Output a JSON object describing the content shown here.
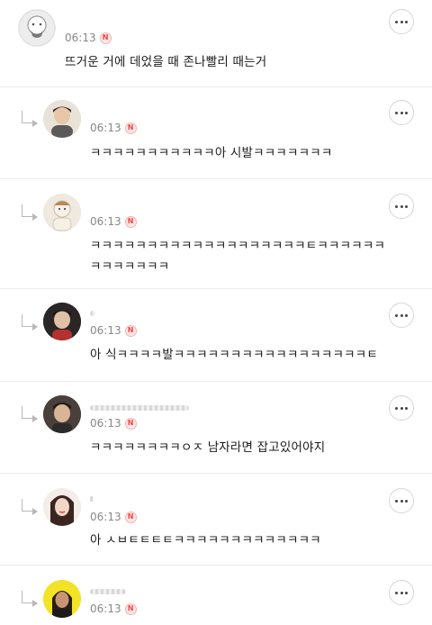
{
  "comments": [
    {
      "time": "06:13",
      "badge": "N",
      "text": "뜨거운 거에 데었을 때 존나빨리 때는거",
      "avatar": "default-avatar-icon"
    },
    {
      "time": "06:13",
      "badge": "N",
      "text": "ㅋㅋㅋㅋㅋㅋㅋㅋㅋㅋㅋ아 시발ㅋㅋㅋㅋㅋㅋㅋ",
      "avatar": "user-avatar"
    },
    {
      "time": "06:13",
      "badge": "N",
      "text": "ㅋㅋㅋㅋㅋㅋㅋㅋㅋㅋㅋㅋㅋㅋㅋㅋㅋㅋㅋㅌㅋㅋㅋㅋㅋㅋ",
      "text2": "ㅋㅋㅋㅋㅋㅋㅋ",
      "avatar": "user-avatar"
    },
    {
      "time": "06:13",
      "badge": "N",
      "text": "아 식ㅋㅋㅋㅋ발ㅋㅋㅋㅋㅋㅋㅋㅋㅋㅋㅋㅋㅋㅋㅋㅋㅋㅌ",
      "avatar": "user-avatar"
    },
    {
      "time": "06:13",
      "badge": "N",
      "text": "ㅋㅋㅋㅋㅋㅋㅋㅋㅇㅈ 남자라면 잡고있어야지",
      "avatar": "user-avatar"
    },
    {
      "time": "06:13",
      "badge": "N",
      "text": "아 ㅅㅂㅌㅌㅌㅌㅋㅋㅋㅋㅋㅋㅋㅋㅋㅋㅋㅋㅋ",
      "avatar": "user-avatar"
    },
    {
      "time": "06:13",
      "badge": "N",
      "text": "",
      "avatar": "user-avatar"
    }
  ],
  "colors": {
    "badge": "#e84a4a",
    "time": "#888888",
    "divider": "#ececec"
  }
}
